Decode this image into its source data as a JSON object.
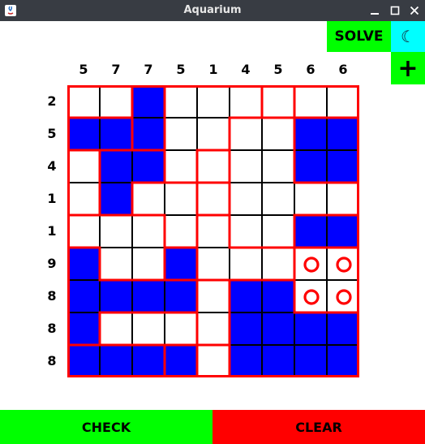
{
  "window": {
    "title": "Aquarium"
  },
  "toolbar": {
    "solve_label": "SOLVE",
    "theme_icon": "☾",
    "new_icon": "+"
  },
  "footer": {
    "check_label": "CHECK",
    "clear_label": "CLEAR"
  },
  "colors": {
    "water": "#0000ff",
    "wall": "#ff0000",
    "check": "#00ff00",
    "clear": "#ff0000",
    "solve": "#00ff00",
    "theme": "#00ffff"
  },
  "puzzle": {
    "size": 9,
    "column_clues": [
      "5",
      "7",
      "7",
      "5",
      "1",
      "4",
      "5",
      "6",
      "6"
    ],
    "row_clues": [
      "2",
      "5",
      "4",
      "1",
      "1",
      "9",
      "8",
      "8",
      "8"
    ],
    "grid": [
      "..W......",
      "WWW....WW",
      ".WW....WW",
      ".W.......",
      ".......WW",
      "W..W...OO",
      "WWWW.WWOO",
      "W....WWWW",
      "WWWW.WWWW"
    ],
    "regions": [
      [
        0,
        0,
        1,
        2,
        2,
        2,
        3,
        4,
        4
      ],
      [
        5,
        5,
        1,
        2,
        2,
        6,
        6,
        7,
        7
      ],
      [
        8,
        9,
        9,
        2,
        10,
        6,
        6,
        7,
        7
      ],
      [
        8,
        9,
        11,
        11,
        12,
        6,
        6,
        6,
        6
      ],
      [
        13,
        13,
        13,
        11,
        14,
        6,
        6,
        15,
        15
      ],
      [
        16,
        13,
        13,
        17,
        14,
        14,
        14,
        18,
        18
      ],
      [
        16,
        16,
        16,
        16,
        19,
        20,
        20,
        18,
        18
      ],
      [
        16,
        21,
        21,
        21,
        19,
        20,
        20,
        20,
        20
      ],
      [
        22,
        22,
        22,
        23,
        24,
        20,
        20,
        20,
        20
      ]
    ]
  }
}
